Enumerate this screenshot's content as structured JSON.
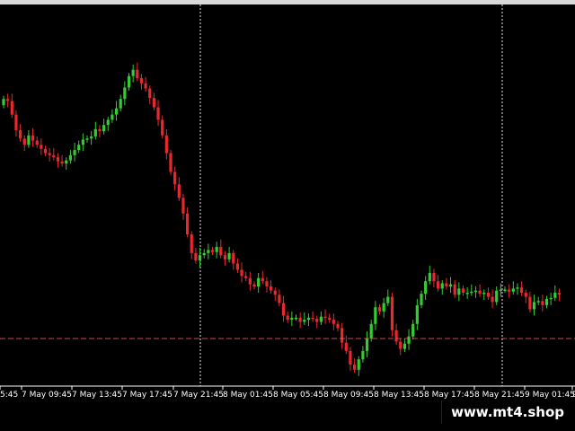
{
  "chart": {
    "symbol_hint": "",
    "background_color": "#000000",
    "bull_color": "#32cd32",
    "bear_color": "#e8272f",
    "grid_color": "#ffffff",
    "level_line_color": "#ff5a5a",
    "time_labels": [
      "5:45",
      "7 May 09:45",
      "7 May 13:45",
      "7 May 17:45",
      "7 May 21:45",
      "8 May 01:45",
      "8 May 05:45",
      "8 May 09:45",
      "8 May 13:45",
      "8 May 17:45",
      "8 May 21:45",
      "9 May 01:45",
      "9"
    ],
    "vertical_separators_at_labels": [
      "7 May 21:45",
      "8 May 21:45"
    ]
  },
  "chart_data": {
    "type": "candlestick",
    "title": "",
    "xlabel": "",
    "ylabel": "",
    "x_start": "7 May 05:45",
    "x_step_minutes": 15,
    "price_levels_relative": "close values shown relative to the horizontal level line (level = 0); higher is up",
    "level_line": 0,
    "ylim": [
      -45,
      275
    ],
    "closes": [
      230,
      228,
      215,
      200,
      192,
      186,
      195,
      190,
      186,
      182,
      178,
      176,
      174,
      170,
      168,
      171,
      176,
      181,
      186,
      191,
      192,
      194,
      201,
      199,
      205,
      210,
      215,
      221,
      230,
      241,
      252,
      258,
      250,
      245,
      240,
      231,
      222,
      210,
      195,
      178,
      160,
      148,
      135,
      120,
      100,
      82,
      75,
      80,
      82,
      85,
      83,
      88,
      80,
      76,
      82,
      72,
      66,
      60,
      58,
      52,
      50,
      58,
      55,
      50,
      46,
      42,
      34,
      22,
      18,
      20,
      20,
      16,
      18,
      20,
      19,
      16,
      21,
      20,
      18,
      14,
      10,
      -4,
      -12,
      -25,
      -30,
      -20,
      -12,
      0,
      14,
      30,
      26,
      34,
      40,
      8,
      -3,
      -10,
      -5,
      2,
      14,
      32,
      43,
      55,
      63,
      55,
      48,
      53,
      50,
      52,
      42,
      48,
      44,
      44,
      45,
      46,
      43,
      44,
      40,
      35,
      46,
      47,
      47,
      45,
      48,
      49,
      44,
      40,
      28,
      35,
      36,
      32,
      38,
      39,
      44,
      42
    ]
  },
  "watermark": {
    "text": "www.mt4.shop"
  }
}
